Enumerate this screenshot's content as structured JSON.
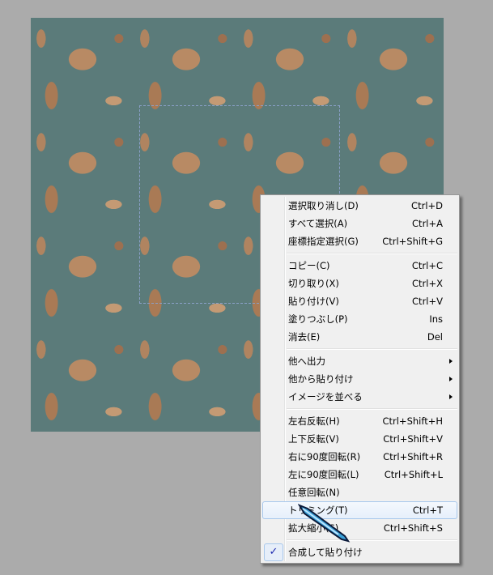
{
  "menu": {
    "group1": [
      {
        "label": "選択取り消し(D)",
        "shortcut": "Ctrl+D"
      },
      {
        "label": "すべて選択(A)",
        "shortcut": "Ctrl+A"
      },
      {
        "label": "座標指定選択(G)",
        "shortcut": "Ctrl+Shift+G"
      }
    ],
    "group2": [
      {
        "label": "コピー(C)",
        "shortcut": "Ctrl+C"
      },
      {
        "label": "切り取り(X)",
        "shortcut": "Ctrl+X"
      },
      {
        "label": "貼り付け(V)",
        "shortcut": "Ctrl+V"
      },
      {
        "label": "塗りつぶし(P)",
        "shortcut": "Ins"
      },
      {
        "label": "消去(E)",
        "shortcut": "Del"
      }
    ],
    "group3": [
      {
        "label": "他へ出力"
      },
      {
        "label": "他から貼り付け"
      },
      {
        "label": "イメージを並べる"
      }
    ],
    "group4": [
      {
        "label": "左右反転(H)",
        "shortcut": "Ctrl+Shift+H"
      },
      {
        "label": "上下反転(V)",
        "shortcut": "Ctrl+Shift+V"
      },
      {
        "label": "右に90度回転(R)",
        "shortcut": "Ctrl+Shift+R"
      },
      {
        "label": "左に90度回転(L)",
        "shortcut": "Ctrl+Shift+L"
      },
      {
        "label": "任意回転(N)",
        "shortcut": ""
      },
      {
        "label": "トリミング(T)",
        "shortcut": "Ctrl+T"
      },
      {
        "label": "拡大縮小(S)",
        "shortcut": "Ctrl+Shift+S"
      }
    ],
    "group5": [
      {
        "label": "合成して貼り付け",
        "checked": true,
        "check": "✓"
      }
    ]
  }
}
